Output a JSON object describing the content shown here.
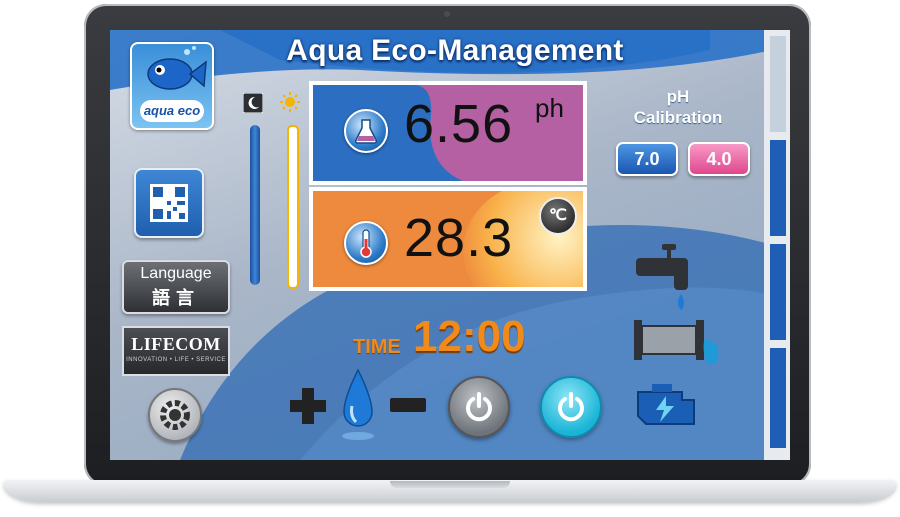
{
  "app": {
    "title": "Aqua Eco-Management",
    "logo_text": "aqua eco"
  },
  "sidebar": {
    "language": {
      "line1": "Language",
      "line2": "語言"
    },
    "brand": {
      "name": "LIFECOM",
      "tagline": "INNOVATION • LIFE • SERVICE"
    }
  },
  "readings": {
    "ph": {
      "value": "6.56",
      "unit": "ph"
    },
    "temperature": {
      "value": "28.3",
      "unit": "℃"
    }
  },
  "time": {
    "label": "TIME",
    "value": "12:00"
  },
  "calibration": {
    "label_line1": "pH",
    "label_line2": "Calibration",
    "buttons": [
      "7.0",
      "4.0"
    ]
  },
  "controls": {
    "plus_icon": "plus-icon",
    "minus_icon": "minus-icon",
    "drop_icon": "water-drop-icon",
    "power_off_icon": "power-icon",
    "power_on_icon": "power-icon"
  },
  "colors": {
    "ph_blue": "#2c6fc2",
    "ph_purple": "#b460a3",
    "temp_orange": "#ee8a3e",
    "time_orange": "#f08a1a",
    "cal_blue": "#1a56b0",
    "cal_pink": "#e0468e",
    "power_cyan": "#19b4d6"
  }
}
